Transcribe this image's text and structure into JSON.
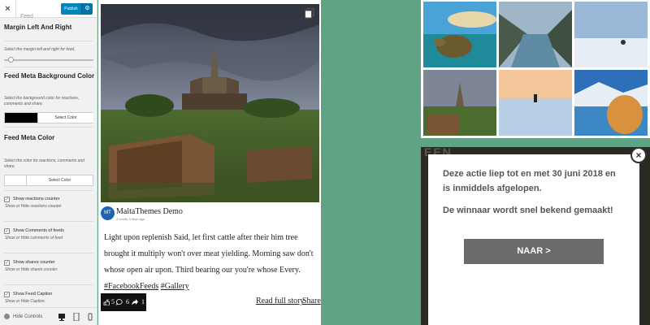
{
  "customizer": {
    "close_glyph": "×",
    "publish_label": "Publish",
    "gear_icon": "gear-icon",
    "panel_title": "Feed",
    "section_margin_title": "Margin Left And Right",
    "section_margin_desc": "Select the margin left and right for feed.",
    "margin_slider_value": 0.05,
    "section_bg_title": "Feed Meta Background Color",
    "section_bg_desc": "Select the background color for reactions, comments and share.",
    "bg_color_value": "#000000",
    "bg_color_button": "Select Color",
    "section_color_title": "Feed Meta Color",
    "section_color_desc": "Select the color for reactions, comments and share.",
    "meta_color_value": "#ffffff",
    "meta_color_button": "Select Color",
    "checkboxes": [
      {
        "label": "Show reactions counter",
        "desc": "Show or Hide reactions counter",
        "checked": true
      },
      {
        "label": "Show Comments of feeds",
        "desc": "Show or Hide comments of feed",
        "checked": true
      },
      {
        "label": "Show shares counter",
        "desc": "Show or Hide shares counter",
        "checked": true
      },
      {
        "label": "Show Feed Caption",
        "desc": "Show or Hide Caption.",
        "checked": true
      }
    ],
    "hide_controls": "Hide Controls",
    "accent": "#0085ba"
  },
  "feed": {
    "author": "MaltaThemes Demo",
    "time": "2 weeks 5 days ago",
    "avatar_text": "MT",
    "caption_text": "Light upon replenish Said, let first cattle after their him tree brought it multiply won't over meat yielding. Morning saw don't whose open air upon. Third bearing our you're whose Every. ",
    "hashtag_1": "#FacebookFeeds",
    "hashtag_2": "#Gallery",
    "reactions_count": "5",
    "comments_count": "6",
    "shares_count": "1",
    "read_full_story": "Read full story",
    "share": "Share"
  },
  "popup": {
    "message_1": "Deze actie liep tot en met 30 juni 2018 en is inmiddels afgelopen.",
    "message_2": "De winnaar wordt snel bekend gemaakt!",
    "button_label": "NAAR >",
    "close_glyph": "×",
    "bg_text": "EEN"
  }
}
